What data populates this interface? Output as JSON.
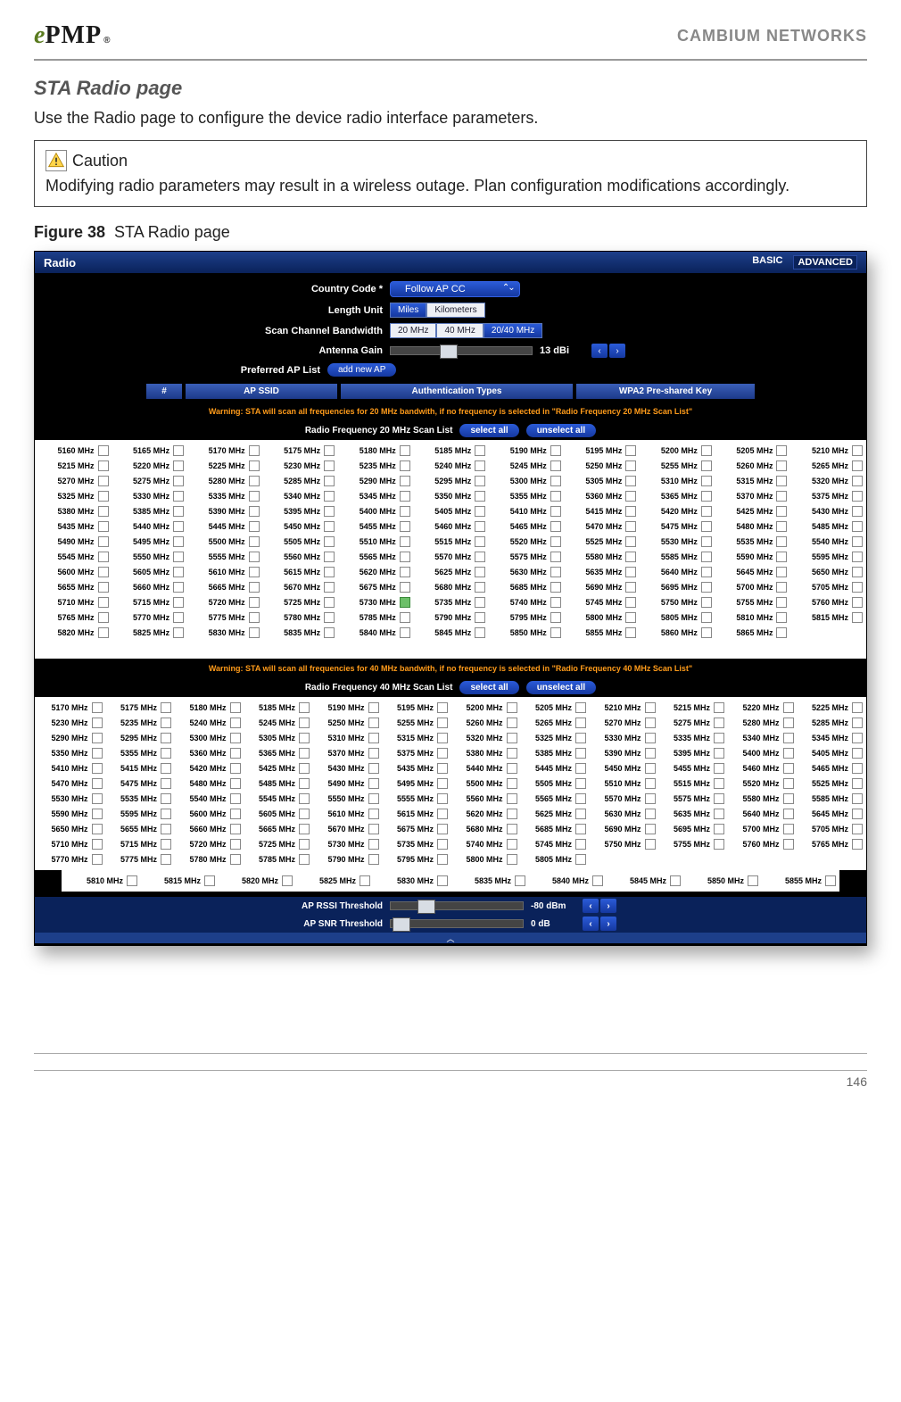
{
  "header": {
    "brand": "CAMBIUM NETWORKS",
    "logo_e": "e",
    "logo_pmp": "PMP",
    "logo_r": "®"
  },
  "section": {
    "title": "STA Radio page",
    "intro": "Use the Radio page to configure the device radio interface parameters."
  },
  "caution": {
    "label": "Caution",
    "text": "Modifying radio parameters may result in a wireless outage. Plan configuration modifications accordingly."
  },
  "figure": {
    "num": "Figure 38",
    "caption": "STA Radio page"
  },
  "panel": {
    "title": "Radio",
    "mode_basic": "BASIC",
    "mode_advanced": "ADVANCED",
    "country_label": "Country Code *",
    "country_value": "Follow AP CC",
    "length_label": "Length Unit",
    "length_options": [
      "Miles",
      "Kilometers"
    ],
    "length_selected": 0,
    "bw_label": "Scan Channel Bandwidth",
    "bw_options": [
      "20 MHz",
      "40 MHz",
      "20/40 MHz"
    ],
    "bw_selected": 2,
    "gain_label": "Antenna Gain",
    "gain_value": "13 dBi",
    "pref_label": "Preferred AP List",
    "pref_btn": "add new AP",
    "tbl_headers": [
      "#",
      "AP SSID",
      "Authentication Types",
      "WPA2 Pre-shared Key"
    ],
    "warn20": "Warning: STA will scan all frequencies for 20 MHz bandwith, if no frequency is selected in \"Radio Frequency 20 MHz Scan List\"",
    "list20_label": "Radio Frequency 20 MHz Scan List",
    "warn40": "Warning: STA will scan all frequencies for 40 MHz bandwith, if no frequency is selected in \"Radio Frequency 40 MHz Scan List\"",
    "list40_label": "Radio Frequency 40 MHz Scan List",
    "select_all": "select all",
    "unselect_all": "unselect all",
    "list20": {
      "start": 5160,
      "end": 5865,
      "step": 5,
      "highlight": 5730,
      "tail_blank_count": 4
    },
    "list40": {
      "start": 5170,
      "end": 5805,
      "step": 5
    },
    "list40_extra": {
      "start": 5810,
      "end": 5855,
      "step": 5
    },
    "rssi_label": "AP RSSI Threshold",
    "rssi_value": "-80 dBm",
    "snr_label": "AP SNR Threshold",
    "snr_value": "0 dB"
  },
  "page_number": "146"
}
